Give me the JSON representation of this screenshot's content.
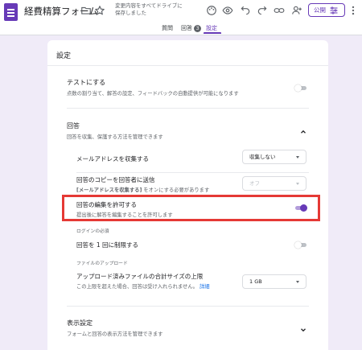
{
  "header": {
    "title": "経費精算フォーム",
    "saved_note_line1": "変更内容をすべてドライブに",
    "saved_note_line2": "保存しました",
    "publish_label": "公開",
    "icons": [
      "folder-icon",
      "star-icon",
      "palette-icon",
      "preview-eye-icon",
      "undo-icon",
      "redo-icon",
      "link-icon",
      "add-collaborator-icon",
      "more-vert-icon"
    ]
  },
  "tabs": [
    {
      "label": "質問"
    },
    {
      "label": "回答",
      "badge": "3"
    },
    {
      "label": "設定",
      "active": true
    }
  ],
  "settings": {
    "title": "設定",
    "quiz": {
      "title": "テストにする",
      "subtitle": "点数の割り当て、解答の設定、フィードバックの自動提供が可能になります",
      "enabled": false
    },
    "responses": {
      "title": "回答",
      "subtitle": "回答を収集、保護する方法を管理できます",
      "collect_email": {
        "label": "メールアドレスを収集する",
        "value": "収集しない"
      },
      "send_copy": {
        "label": "回答のコピーを回答者に送信",
        "note_bold": "[メールアドレスを収集する]",
        "note_rest": " をオンにする必要があります",
        "value": "オフ"
      },
      "allow_edit": {
        "label": "回答の編集を許可する",
        "subtitle": "提出後に解答を編集することを許可します",
        "enabled": true
      },
      "login_heading": "ログインの必須",
      "limit_one": {
        "label": "回答を 1 回に制限する",
        "enabled": false
      },
      "upload_heading": "ファイルのアップロード",
      "upload_size": {
        "label": "アップロード済みファイルの合計サイズの上限",
        "note": "この上限を超えた場合、回答は受け入れられません。",
        "link": "詳細",
        "value": "1 GB"
      }
    },
    "presentation": {
      "title": "表示設定",
      "subtitle": "フォームと回答の表示方法を管理できます"
    }
  },
  "colors": {
    "accent": "#673ab7",
    "highlight": "#e53935",
    "link": "#1a73e8"
  }
}
